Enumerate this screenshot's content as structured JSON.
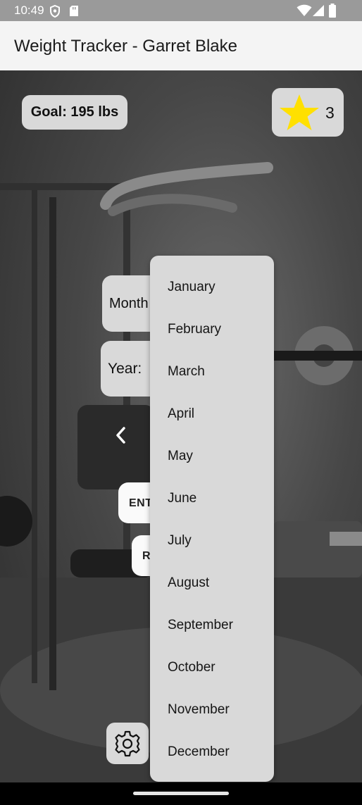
{
  "status_bar": {
    "time": "10:49",
    "icons": [
      "shield-icon",
      "sd-card-icon",
      "wifi-icon",
      "signal-icon",
      "battery-icon"
    ]
  },
  "app_bar": {
    "title": "Weight Tracker - Garret Blake"
  },
  "goal": {
    "label": "Goal: 195 lbs"
  },
  "stars": {
    "count": "3",
    "icon": "star-icon",
    "color": "#FFE000"
  },
  "form": {
    "month_label": "Month",
    "year_label": "Year:",
    "enter_label": "ENT",
    "reset_label": "R"
  },
  "month_dropdown": {
    "options": [
      "January",
      "February",
      "March",
      "April",
      "May",
      "June",
      "July",
      "August",
      "September",
      "October",
      "November",
      "December"
    ]
  },
  "settings": {
    "icon": "gear-icon"
  }
}
